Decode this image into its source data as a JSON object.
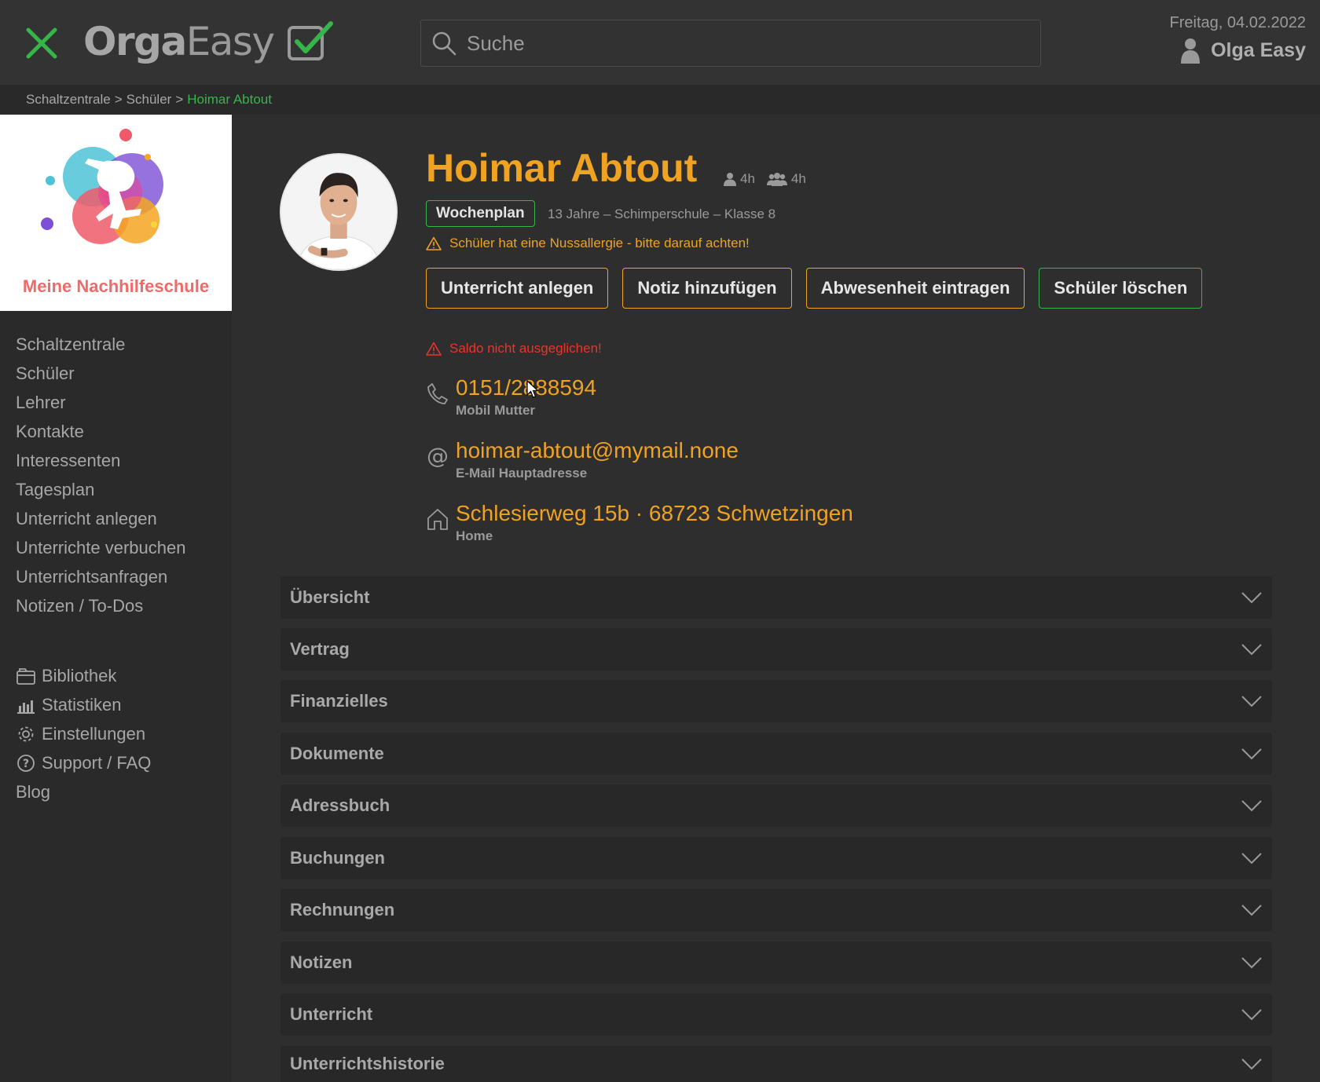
{
  "header": {
    "logo_bold": "Orga",
    "logo_light": "Easy",
    "search_placeholder": "Suche",
    "date": "Freitag, 04.02.2022",
    "user_name": "Olga Easy"
  },
  "breadcrumb": {
    "items": [
      "Schaltzentrale",
      "Schüler"
    ],
    "separator": ">",
    "current": "Hoimar Abtout"
  },
  "sidebar": {
    "school_name": "Meine Nachhilfeschule",
    "nav": [
      "Schaltzentrale",
      "Schüler",
      "Lehrer",
      "Kontakte",
      "Interessenten",
      "Tagesplan",
      "Unterricht anlegen",
      "Unterrichte verbuchen",
      "Unterrichtsanfragen",
      "Notizen / To-Dos"
    ],
    "tools": [
      {
        "label": "Bibliothek",
        "icon": "library-icon"
      },
      {
        "label": "Statistiken",
        "icon": "statistics-icon"
      },
      {
        "label": "Einstellungen",
        "icon": "gear-icon"
      },
      {
        "label": "Support / FAQ",
        "icon": "help-icon"
      },
      {
        "label": "Blog",
        "icon": ""
      }
    ]
  },
  "student": {
    "name": "Hoimar Abtout",
    "hours_single": "4h",
    "hours_group": "4h",
    "badge": "Wochenplan",
    "meta": "13 Jahre – Schimperschule – Klasse 8",
    "allergy_warning": "Schüler hat eine Nussallergie - bitte darauf achten!",
    "saldo_warning": "Saldo nicht ausgeglichen!"
  },
  "actions": {
    "create_lesson": "Unterricht anlegen",
    "add_note": "Notiz hinzufügen",
    "add_absence": "Abwesenheit eintragen",
    "delete_student": "Schüler löschen"
  },
  "contacts": {
    "phone": {
      "value": "0151/2888594",
      "label": "Mobil Mutter"
    },
    "email": {
      "value": "hoimar-abtout@mymail.none",
      "label": "E-Mail Hauptadresse"
    },
    "address": {
      "value": "Schlesierweg 15b · 68723 Schwetzingen",
      "label": "Home"
    }
  },
  "sections": [
    "Übersicht",
    "Vertrag",
    "Finanzielles",
    "Dokumente",
    "Adressbuch",
    "Buchungen",
    "Rechnungen",
    "Notizen",
    "Unterricht",
    "Unterrichtshistorie"
  ],
  "colors": {
    "accent_orange": "#f0a221",
    "accent_green": "#36b54a",
    "warning_red": "#e8352c",
    "school_name": "#f06a6a"
  }
}
